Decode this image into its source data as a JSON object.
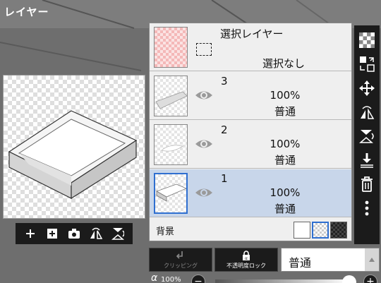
{
  "panel": {
    "title": "レイヤー"
  },
  "preview_toolbar": {
    "icons": [
      "add-layer-icon",
      "add-frame-icon",
      "camera-icon",
      "flip-horizontal-icon",
      "flip-vertical-icon"
    ]
  },
  "selection_layer": {
    "name": "選択レイヤー",
    "status": "選択なし"
  },
  "layers": [
    {
      "number": "3",
      "opacity": "100%",
      "blend": "普通",
      "selected": false
    },
    {
      "number": "2",
      "opacity": "100%",
      "blend": "普通",
      "selected": false
    },
    {
      "number": "1",
      "opacity": "100%",
      "blend": "普通",
      "selected": true
    }
  ],
  "background": {
    "label": "背景",
    "selected_swatch": "checker"
  },
  "side_toolbar": {
    "icons": [
      "checker-icon",
      "swap-icon",
      "move-icon",
      "rotate-flip-horizontal-icon",
      "rotate-flip-vertical-icon",
      "merge-down-icon",
      "trash-icon",
      "more-icon"
    ]
  },
  "bottom": {
    "clipping_label": "クリッピング",
    "alpha_lock_label": "不透明度ロック",
    "blend_mode": "普通"
  },
  "opacity_control": {
    "symbol": "α",
    "value": "100%",
    "level": 1.0
  },
  "colors": {
    "selected_row": "#c8d6ea",
    "accent": "#2f6fd0",
    "toolbar": "#1b1b1b"
  }
}
